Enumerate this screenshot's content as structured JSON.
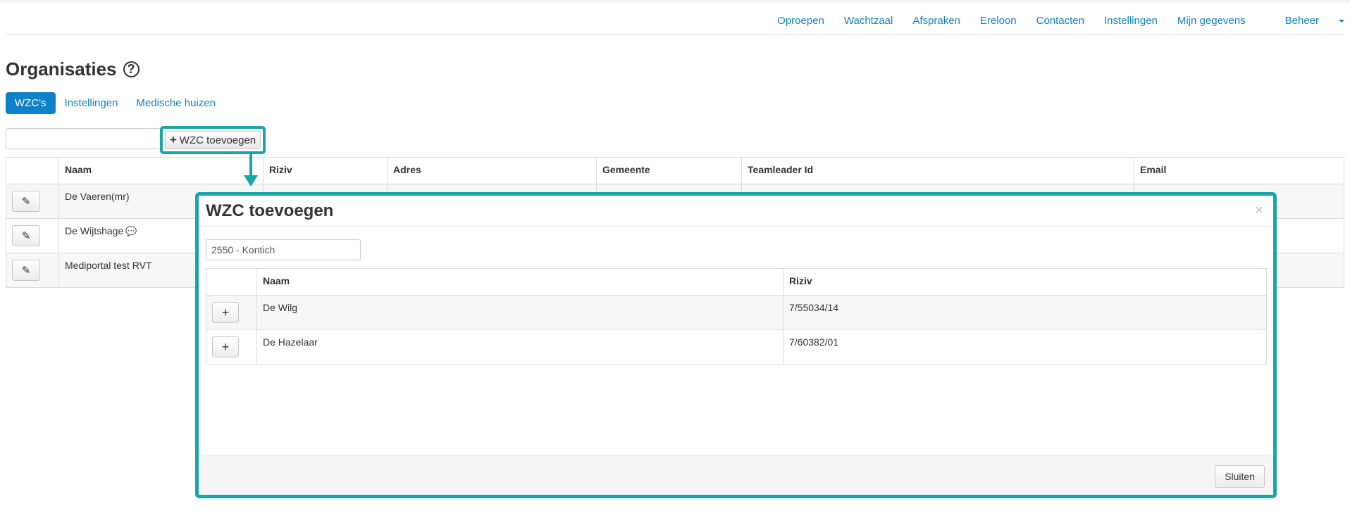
{
  "nav": {
    "items": [
      "Oproepen",
      "Wachtzaal",
      "Afspraken",
      "Ereloon",
      "Contacten",
      "Instellingen",
      "Mijn gegevens",
      "Beheer"
    ]
  },
  "page": {
    "title": "Organisaties",
    "help_icon": "question-circle-icon"
  },
  "tabs": [
    {
      "label": "WZC's",
      "active": true
    },
    {
      "label": "Instellingen",
      "active": false
    },
    {
      "label": "Medische huizen",
      "active": false
    }
  ],
  "toolbar": {
    "filter_value": "",
    "add_button_label": "WZC toevoegen",
    "add_icon": "plus-icon"
  },
  "main_table": {
    "headers": [
      "",
      "Naam",
      "Riziv",
      "Adres",
      "Gemeente",
      "Teamleader Id",
      "Email"
    ],
    "rows": [
      {
        "naam": "De Vaeren(mr)"
      },
      {
        "naam": "De Wijtshage"
      },
      {
        "naam": "Mediportal test RVT"
      }
    ],
    "edit_icon": "pencil-icon",
    "comment_icon": "speech-bubble-icon"
  },
  "modal": {
    "title": "WZC toevoegen",
    "close_glyph": "×",
    "search_value": "2550 - Kontich",
    "headers": [
      "",
      "Naam",
      "Riziv"
    ],
    "rows": [
      {
        "naam": "De Wilg",
        "riziv": "7/55034/14"
      },
      {
        "naam": "De Hazelaar",
        "riziv": "7/60382/01"
      }
    ],
    "close_button_label": "Sluiten",
    "highlight_color": "#1aa6a6"
  },
  "colors": {
    "accent": "#0f81c8",
    "callout": "#1aa6a6"
  }
}
